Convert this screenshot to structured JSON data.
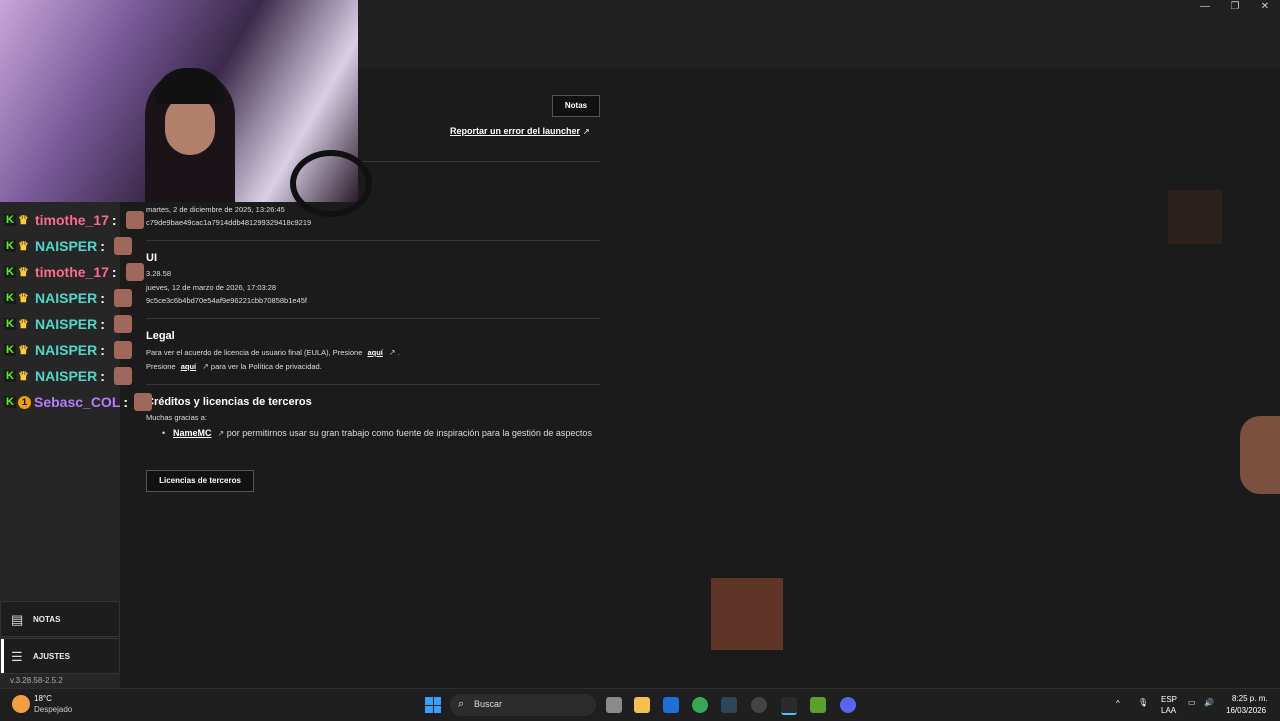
{
  "window": {
    "minimize": "—",
    "restore": "❐",
    "close": "✕"
  },
  "header": {
    "notes_button": "Notas",
    "report_link": "Reportar un error del launcher"
  },
  "launcher_section": {
    "date": "martes, 2 de diciembre de 2025, 13:26:45",
    "hash": "c79de9bae49cac1a7914ddb481299329418c9219"
  },
  "ui_section": {
    "title": "UI",
    "version": "3.28.58",
    "date": "jueves, 12 de marzo de 2026, 17:03:28",
    "hash": "9c5ce3c6b4bd70e54af9e96221cbb70858b1e45f"
  },
  "legal": {
    "title": "Legal",
    "eula_text": "Para ver el acuerdo de licencia de usuario final (EULA), Presione",
    "eula_link": "aquí",
    "eula_end": ".",
    "privacy_start": "Presione",
    "privacy_link": "aquí",
    "privacy_text": "para ver la Política de privacidad."
  },
  "credits": {
    "title": "Créditos y licencias de terceros",
    "thanks": "Muchas gracias a:",
    "items": [
      {
        "link": "NameMC",
        "text": "por permitirnos usar su gran trabajo como fuente de inspiración para la gestión de aspectos"
      }
    ],
    "licenses_button": "Licencias de terceros"
  },
  "sidebar": {
    "items": [
      {
        "label": "NOTAS",
        "icon": "notes-icon"
      },
      {
        "label": "AJUSTES",
        "icon": "sliders-icon"
      }
    ],
    "version": "v.3.28.58-2.5.2"
  },
  "chat": {
    "messages": [
      {
        "user": "timothe_17",
        "color": "#ff6b8a",
        "badge": "crown"
      },
      {
        "user": "NAISPER",
        "color": "#4fd8c8",
        "badge": "crown"
      },
      {
        "user": "timothe_17",
        "color": "#ff6b8a",
        "badge": "crown"
      },
      {
        "user": "NAISPER",
        "color": "#4fd8c8",
        "badge": "crown"
      },
      {
        "user": "NAISPER",
        "color": "#4fd8c8",
        "badge": "crown"
      },
      {
        "user": "NAISPER",
        "color": "#4fd8c8",
        "badge": "crown"
      },
      {
        "user": "NAISPER",
        "color": "#4fd8c8",
        "badge": "crown"
      },
      {
        "user": "Sebasc_COL",
        "color": "#b77cff",
        "badge": "one"
      }
    ],
    "colon": ":"
  },
  "taskbar": {
    "weather_temp": "18°C",
    "weather_desc": "Despejado",
    "search_placeholder": "Buscar",
    "lang": "ESP",
    "layout": "LAA",
    "time": "8:25 p. m.",
    "date": "16/03/2026"
  }
}
